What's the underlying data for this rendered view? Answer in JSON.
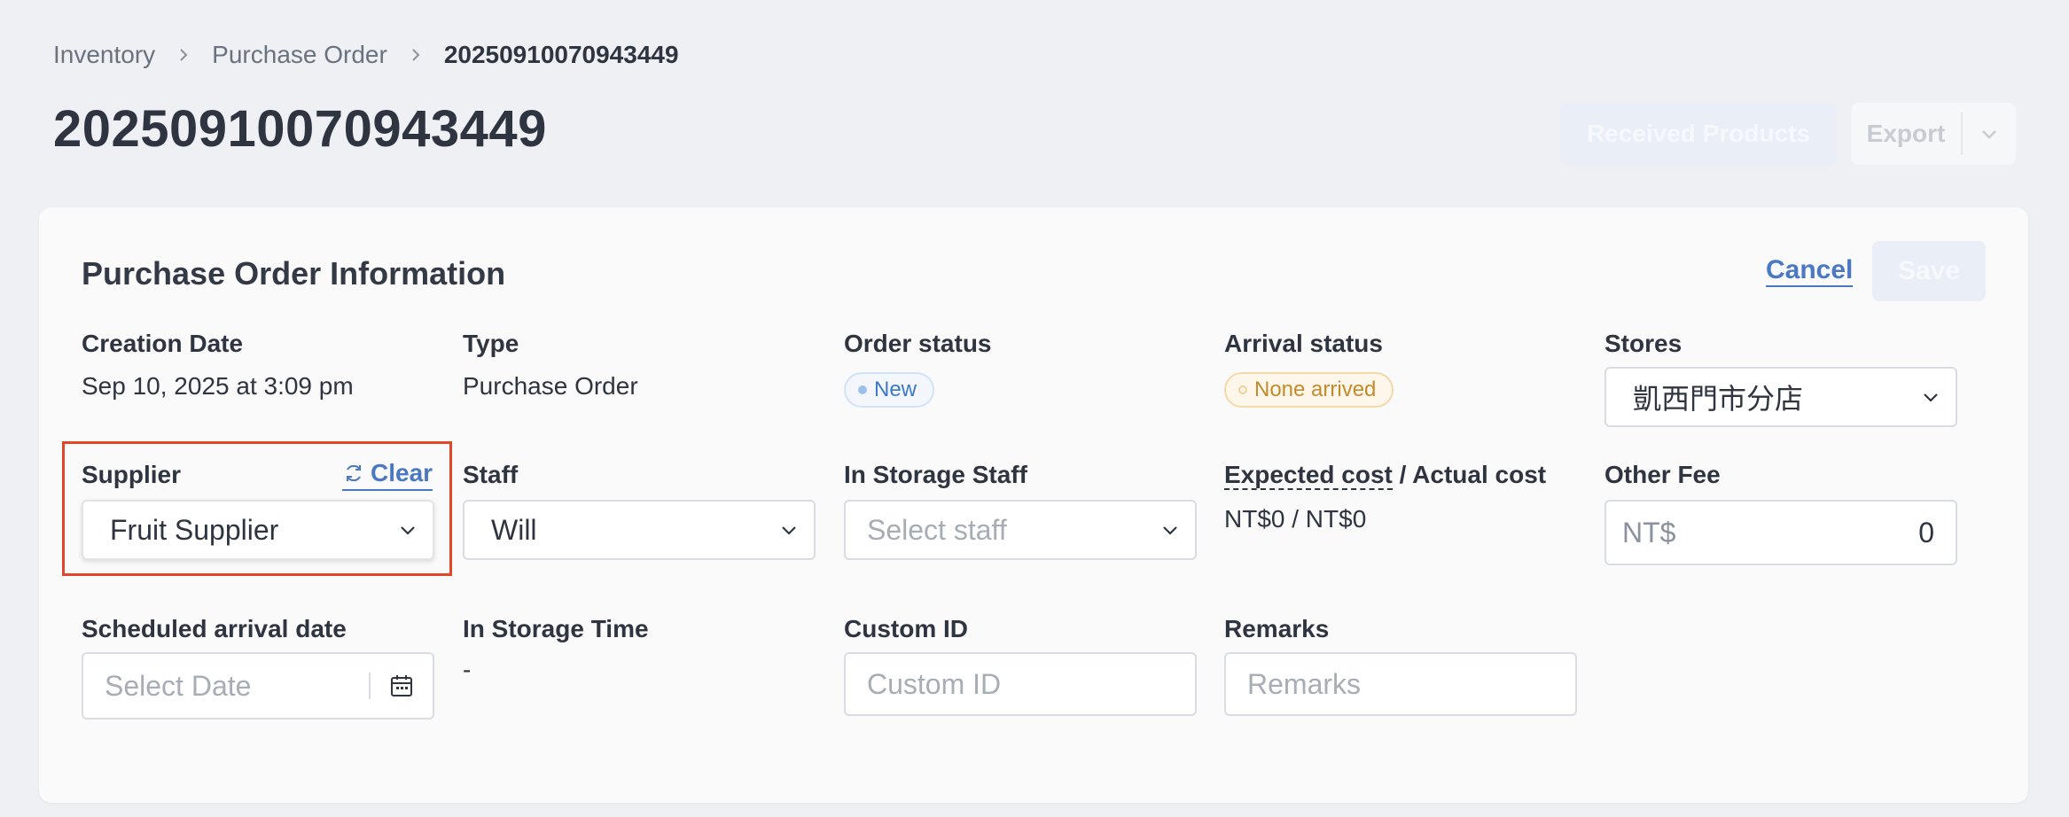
{
  "breadcrumb": {
    "items": [
      "Inventory",
      "Purchase Order"
    ],
    "current": "20250910070943449"
  },
  "page_title": "20250910070943449",
  "header_actions": {
    "received_label": "Received Products",
    "export_label": "Export"
  },
  "card": {
    "title": "Purchase Order Information",
    "cancel_label": "Cancel",
    "save_label": "Save"
  },
  "fields": {
    "creation_date": {
      "label": "Creation Date",
      "value": "Sep 10, 2025 at 3:09 pm"
    },
    "type": {
      "label": "Type",
      "value": "Purchase Order"
    },
    "order_status": {
      "label": "Order status",
      "value": "New"
    },
    "arrival_status": {
      "label": "Arrival status",
      "value": "None arrived"
    },
    "stores": {
      "label": "Stores",
      "value": "凱西門市分店"
    },
    "supplier": {
      "label": "Supplier",
      "value": "Fruit Supplier",
      "clear_label": "Clear"
    },
    "staff": {
      "label": "Staff",
      "value": "Will"
    },
    "in_storage_staff": {
      "label": "In Storage Staff",
      "placeholder": "Select staff"
    },
    "cost": {
      "label_expected": "Expected cost",
      "label_sep": " / ",
      "label_actual": "Actual cost",
      "value": "NT$0 / NT$0"
    },
    "other_fee": {
      "label": "Other Fee",
      "prefix": "NT$",
      "value": "0"
    },
    "scheduled_arrival": {
      "label": "Scheduled arrival date",
      "placeholder": "Select Date"
    },
    "in_storage_time": {
      "label": "In Storage Time",
      "value": "-"
    },
    "custom_id": {
      "label": "Custom ID",
      "placeholder": "Custom ID"
    },
    "remarks": {
      "label": "Remarks",
      "placeholder": "Remarks"
    }
  },
  "colors": {
    "accent": "#4a78c2",
    "highlight": "#e0472a",
    "status_new": "#3c78c8",
    "status_arrival": "#c48b2a"
  },
  "icons": {
    "breadcrumb_separator": "chevron-right-icon",
    "dropdown": "chevron-down-icon",
    "clear": "refresh-icon",
    "date": "calendar-icon"
  }
}
